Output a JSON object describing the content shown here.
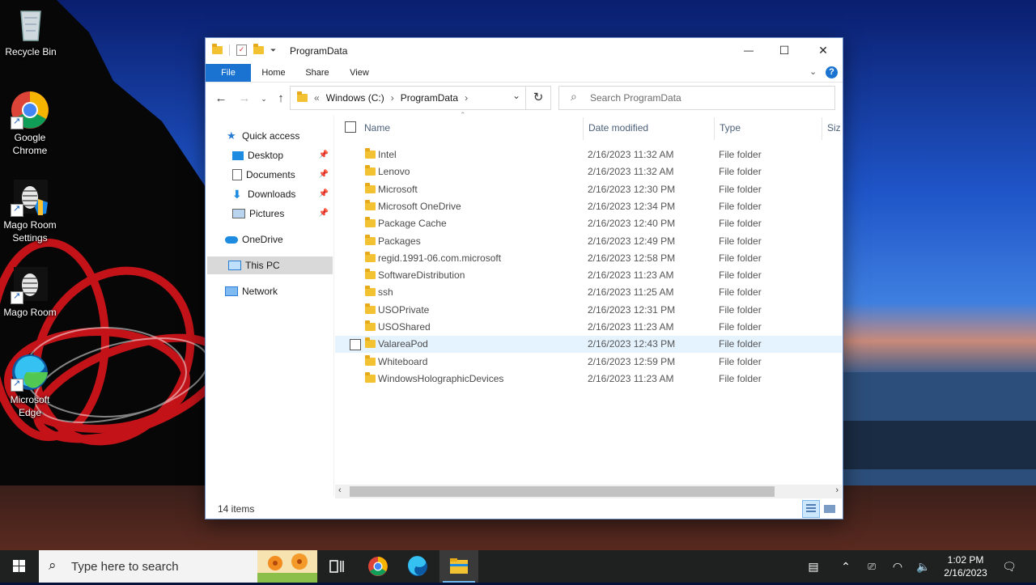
{
  "desktop": {
    "icons": [
      {
        "label": "Recycle Bin"
      },
      {
        "label": "Google Chrome"
      },
      {
        "label": "Mago Room Settings"
      },
      {
        "label": "Mago Room"
      },
      {
        "label": "Microsoft Edge"
      }
    ]
  },
  "window": {
    "title": "ProgramData",
    "controls": {
      "minimize": "—",
      "maximize": "☐",
      "close": "✕"
    },
    "ribbon_tabs": [
      "File",
      "Home",
      "Share",
      "View"
    ],
    "address": {
      "prefix": "«",
      "crumbs": [
        "Windows (C:)",
        "ProgramData"
      ]
    },
    "search": {
      "placeholder": "Search ProgramData"
    },
    "nav_pane": {
      "quick_access": "Quick access",
      "pinned": [
        "Desktop",
        "Documents",
        "Downloads",
        "Pictures"
      ],
      "onedrive": "OneDrive",
      "this_pc": "This PC",
      "network": "Network"
    },
    "columns": {
      "name": "Name",
      "date": "Date modified",
      "type": "Type",
      "size": "Siz"
    },
    "files": [
      {
        "name": "Intel",
        "date": "2/16/2023 11:32 AM",
        "type": "File folder"
      },
      {
        "name": "Lenovo",
        "date": "2/16/2023 11:32 AM",
        "type": "File folder"
      },
      {
        "name": "Microsoft",
        "date": "2/16/2023 12:30 PM",
        "type": "File folder"
      },
      {
        "name": "Microsoft OneDrive",
        "date": "2/16/2023 12:34 PM",
        "type": "File folder"
      },
      {
        "name": "Package Cache",
        "date": "2/16/2023 12:40 PM",
        "type": "File folder"
      },
      {
        "name": "Packages",
        "date": "2/16/2023 12:49 PM",
        "type": "File folder"
      },
      {
        "name": "regid.1991-06.com.microsoft",
        "date": "2/16/2023 12:58 PM",
        "type": "File folder"
      },
      {
        "name": "SoftwareDistribution",
        "date": "2/16/2023 11:23 AM",
        "type": "File folder"
      },
      {
        "name": "ssh",
        "date": "2/16/2023 11:25 AM",
        "type": "File folder"
      },
      {
        "name": "USOPrivate",
        "date": "2/16/2023 12:31 PM",
        "type": "File folder"
      },
      {
        "name": "USOShared",
        "date": "2/16/2023 11:23 AM",
        "type": "File folder"
      },
      {
        "name": "ValareaPod",
        "date": "2/16/2023 12:43 PM",
        "type": "File folder"
      },
      {
        "name": "Whiteboard",
        "date": "2/16/2023 12:59 PM",
        "type": "File folder"
      },
      {
        "name": "WindowsHolographicDevices",
        "date": "2/16/2023 11:23 AM",
        "type": "File folder"
      }
    ],
    "status": {
      "item_count": "14 items"
    }
  },
  "taskbar": {
    "search_placeholder": "Type here to search",
    "clock": {
      "time": "1:02 PM",
      "date": "2/16/2023"
    }
  },
  "colors": {
    "accent": "#1a73d0",
    "folder": "#f3c233",
    "taskbar": "#1f2020",
    "hover_row": "#e5f3ff"
  }
}
